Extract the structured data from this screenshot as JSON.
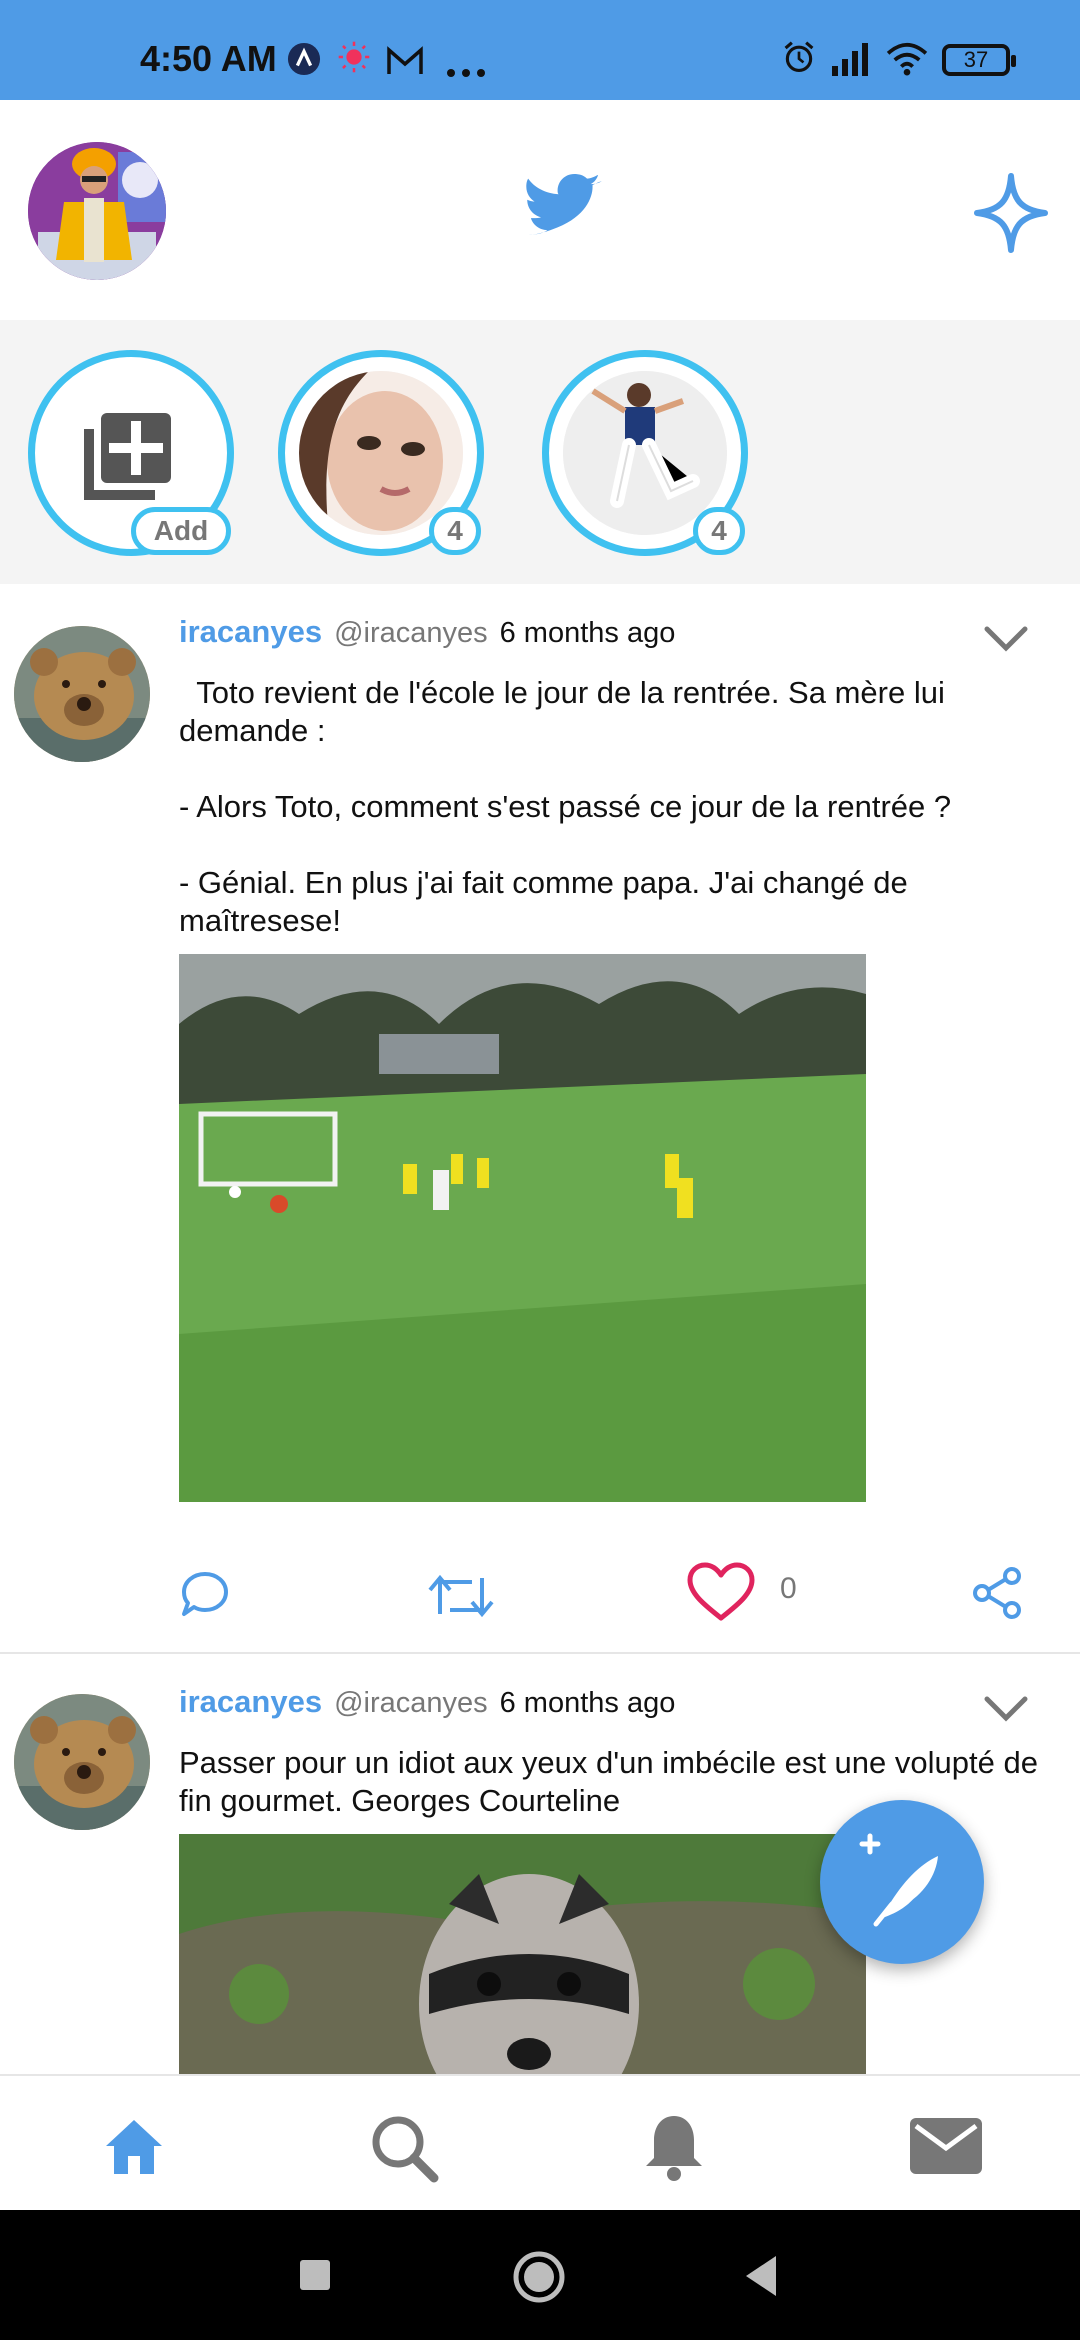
{
  "status_bar": {
    "time": "4:50 AM",
    "battery": "37",
    "icons": [
      "a-badge-icon",
      "sun-icon",
      "mail-m-icon",
      "more-dots-icon",
      "alarm-icon",
      "signal-icon",
      "wifi-icon",
      "battery-icon"
    ]
  },
  "header": {
    "logo": "twitter-bird-icon",
    "action": "sparkle-icon"
  },
  "stories": [
    {
      "badge": "Add",
      "icon": "add-story-icon"
    },
    {
      "badge": "4"
    },
    {
      "badge": "4"
    }
  ],
  "tweets": [
    {
      "name": "iracanyes",
      "handle": "@iracanyes",
      "time": "6 months ago",
      "lines": [
        "  Toto revient de l'école le jour de la rentrée. Sa mère lui demande :",
        "",
        "- Alors Toto, comment s'est passé ce jour de la rentrée ?",
        "",
        "- Génial. En plus j'ai fait comme papa. J'ai changé de maîtresese!"
      ],
      "media": "soccer-field-photo",
      "likes": "0"
    },
    {
      "name": "iracanyes",
      "handle": "@iracanyes",
      "time": "6 months ago",
      "lines": [
        "Passer pour un idiot aux yeux d'un imbécile est une volupté de fin gourmet. Georges Courteline"
      ],
      "media": "raccoon-photo"
    }
  ],
  "nav": [
    "home-icon",
    "search-icon",
    "bell-icon",
    "mail-icon"
  ],
  "colors": {
    "accent": "#4f9be6",
    "story_ring": "#3fc1f0",
    "like": "#e0245e"
  }
}
